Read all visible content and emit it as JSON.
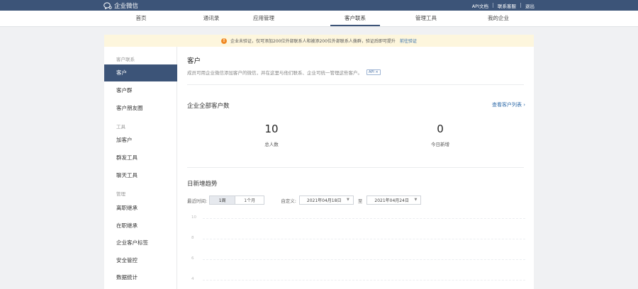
{
  "topbar": {
    "brand": "企业微信",
    "links": [
      "API文档",
      "联系客服",
      "退出"
    ]
  },
  "nav": {
    "items": [
      "首页",
      "通讯录",
      "应用管理",
      "客户联系",
      "管理工具",
      "我的企业"
    ],
    "active": "客户联系"
  },
  "notice": {
    "icon": "warning-icon",
    "text": "企业未验证，仅可添加200位外部联系人和被添200位外部联系人拨群，验证后即可提升",
    "link": "前往验证"
  },
  "sidebar": {
    "group1": "客户联系",
    "items1": [
      "客户",
      "客户群",
      "客户朋友圈"
    ],
    "group2": "工具",
    "items2": [
      "加客户",
      "群发工具",
      "聊天工具"
    ],
    "group3": "管理",
    "items3": [
      "离职继承",
      "在职继承",
      "企业客户标签",
      "安全管控",
      "数据统计"
    ]
  },
  "main": {
    "title": "客户",
    "description": "成员可用企业微信添加客户的微信，并在这里与他们联系、企业可统一管理这些客户。",
    "api_tag": "API ×",
    "total_section": {
      "title": "企业全部客户数",
      "link": "查看客户列表 ›",
      "total_value": "10",
      "total_label": "总人数",
      "new_value": "0",
      "new_label": "今日新增"
    },
    "trend": {
      "title": "日新增趋势",
      "recent_label": "最近时间:",
      "range_options": [
        "1周",
        "1个月"
      ],
      "range_selected": "1周",
      "custom_label": "自定义:",
      "start_date": "2021年04月18日",
      "separator": "至",
      "end_date": "2021年04月24日"
    }
  },
  "chart_data": {
    "type": "line",
    "title": "",
    "yticks": [
      "10",
      "8",
      "6",
      "4"
    ],
    "series": []
  },
  "colors": {
    "topbar": "#3c5478",
    "accent": "#3c5478",
    "link": "#2e6aa8",
    "notice_bg": "#fdf6dd",
    "warn": "#f08a24"
  }
}
